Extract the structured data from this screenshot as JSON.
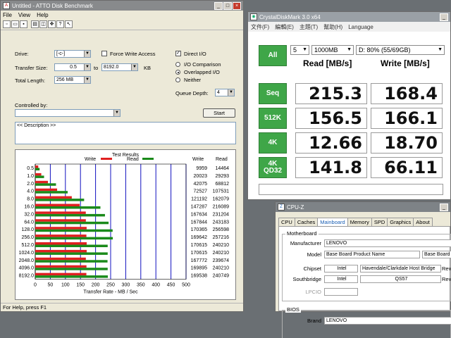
{
  "atto": {
    "title": "Untitled - ATTO Disk Benchmark",
    "menu": [
      "File",
      "View",
      "Help"
    ],
    "drive_label": "Drive:",
    "drive_value": "[-c-]",
    "force_write_label": "Force Write Access",
    "direct_io_label": "Direct I/O",
    "transfer_label": "Transfer Size:",
    "transfer_from": "0.5",
    "transfer_to_label": "to",
    "transfer_to": "8192.0",
    "transfer_unit": "KB",
    "total_length_label": "Total Length:",
    "total_length_value": "256 MB",
    "io_comparison": "I/O Comparison",
    "overlapped_io": "Overlapped I/O",
    "neither": "Neither",
    "queue_depth_label": "Queue Depth:",
    "queue_depth_value": "4",
    "controlled_by_label": "Controlled by:",
    "start_button": "Start",
    "description": "<< Description >>",
    "status_bar": "For Help, press F1",
    "results": {
      "title": "Test Results",
      "write_legend": "Write",
      "read_legend": "Read",
      "col_write": "Write",
      "col_read": "Read",
      "x_title": "Transfer Rate - MB / Sec",
      "x_ticks": [
        "0",
        "50",
        "100",
        "150",
        "200",
        "250",
        "300",
        "350",
        "400",
        "450",
        "500"
      ]
    },
    "colors": {
      "write": "#e02020",
      "read": "#1a8a1a",
      "grid": "#1010c0"
    }
  },
  "chart_data": {
    "type": "bar",
    "title": "Test Results",
    "xlabel": "Transfer Rate - MB / Sec",
    "xlim": [
      0,
      500
    ],
    "categories": [
      "0.5",
      "1.0",
      "2.0",
      "4.0",
      "8.0",
      "16.0",
      "32.0",
      "64.0",
      "128.0",
      "256.0",
      "512.0",
      "1024.0",
      "2048.0",
      "4096.0",
      "8192.0"
    ],
    "series": [
      {
        "name": "Write",
        "values": [
          9959,
          20023,
          42075,
          72527,
          121192,
          147287,
          167634,
          167844,
          170365,
          169642,
          170615,
          170615,
          167772,
          169895,
          169538
        ]
      },
      {
        "name": "Read",
        "values": [
          14464,
          29293,
          68812,
          107531,
          162079,
          216089,
          231204,
          243183,
          256598,
          257216,
          240210,
          240210,
          239674,
          240210,
          240749
        ]
      }
    ]
  },
  "cdm": {
    "title": "CrystalDiskMark 3.0 x64",
    "menu": [
      "文件(F)",
      "編輯(E)",
      "主題(T)",
      "幫助(H)",
      "Language"
    ],
    "runs": "5",
    "size": "1000MB",
    "drive": "D: 80% (55/69GB)",
    "all_button": "All",
    "read_header": "Read [MB/s]",
    "write_header": "Write [MB/s]",
    "rows": [
      {
        "label": "Seq",
        "read": "215.3",
        "write": "168.4"
      },
      {
        "label": "512K",
        "read": "156.5",
        "write": "166.1"
      },
      {
        "label": "4K",
        "read": "12.66",
        "write": "18.70"
      },
      {
        "label": "4K\nQD32",
        "read": "141.8",
        "write": "66.11"
      }
    ],
    "colors": {
      "button": "#3fa648"
    }
  },
  "cpuz": {
    "title": "CPU-Z",
    "tabs": [
      "CPU",
      "Caches",
      "Mainboard",
      "Memory",
      "SPD",
      "Graphics",
      "About"
    ],
    "active_tab": "Mainboard",
    "motherboard_group": "Motherboard",
    "manufacturer_label": "Manufacturer",
    "manufacturer": "LENOVO",
    "model_label": "Model",
    "model": "Base Board Product Name",
    "model_version": "Base Board V",
    "chipset_label": "Chipset",
    "chipset_vendor": "Intel",
    "chipset_name": "Havendale/Clarkdale Host Bridge",
    "rev_label": "Rev.",
    "southbridge_label": "Southbridge",
    "southbridge_vendor": "Intel",
    "southbridge_name": "QS57",
    "lpcio_label": "LPCIO",
    "bios_group": "BIOS",
    "brand_label": "Brand",
    "brand": "LENOVO"
  }
}
